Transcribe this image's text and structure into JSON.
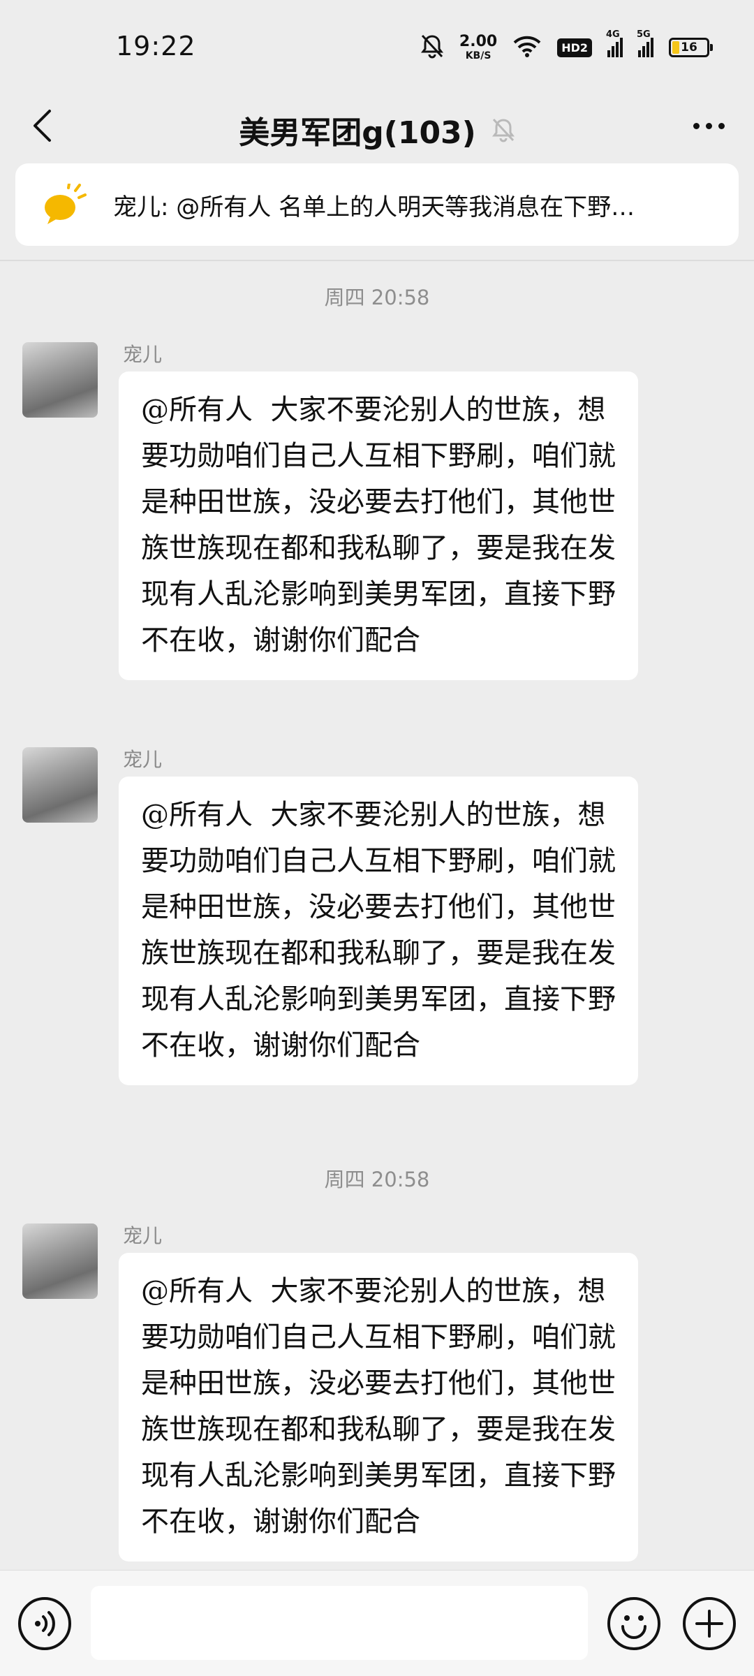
{
  "status_bar": {
    "time": "19:22",
    "net_speed_value": "2.00",
    "net_speed_unit": "KB/S",
    "hd_label": "HD2",
    "signal_4g_label": "4G",
    "signal_5g_label": "5G",
    "battery_level": "16",
    "icons": [
      "mute-bell-icon",
      "wifi-icon",
      "hd-icon",
      "signal-4g-icon",
      "signal-5g-icon",
      "battery-icon"
    ]
  },
  "nav": {
    "title": "美男军团g(103)",
    "icons": [
      "back-icon",
      "mute-bell-icon",
      "more-icon"
    ]
  },
  "pinned": {
    "text": "宠儿: @所有人  名单上的人明天等我消息在下野…",
    "icon": "announcement-icon",
    "accent_color": "#f5b800"
  },
  "chat": {
    "timestamp_1": "周四 20:58",
    "timestamp_2": "周四 20:58",
    "messages": [
      {
        "sender": "宠儿",
        "text": "@所有人  大家不要沦别人的世族，想要功勋咱们自己人互相下野刷，咱们就是种田世族，没必要去打他们，其他世族世族现在都和我私聊了，要是我在发现有人乱沦影响到美男军团，直接下野不在收，谢谢你们配合"
      },
      {
        "sender": "宠儿",
        "text": "@所有人  大家不要沦别人的世族，想要功勋咱们自己人互相下野刷，咱们就是种田世族，没必要去打他们，其他世族世族现在都和我私聊了，要是我在发现有人乱沦影响到美男军团，直接下野不在收，谢谢你们配合"
      },
      {
        "sender": "宠儿",
        "text": "@所有人  大家不要沦别人的世族，想要功勋咱们自己人互相下野刷，咱们就是种田世族，没必要去打他们，其他世族世族现在都和我私聊了，要是我在发现有人乱沦影响到美男军团，直接下野不在收，谢谢你们配合"
      }
    ]
  },
  "input_bar": {
    "placeholder": "",
    "icons": [
      "voice-icon",
      "emoji-icon",
      "plus-icon"
    ]
  },
  "colors": {
    "background": "#ededed",
    "bubble": "#ffffff",
    "secondary_text": "#8e8e8e"
  }
}
